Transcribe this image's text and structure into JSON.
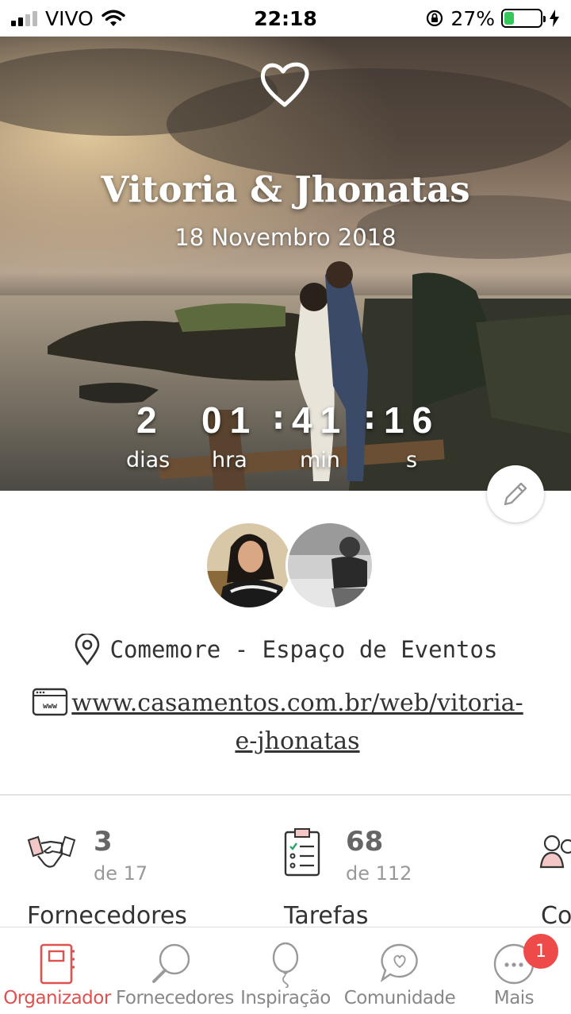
{
  "status_bar": {
    "carrier": "VIVO",
    "time": "22:18",
    "battery_percent": "27%",
    "battery_level": 0.27,
    "battery_color": "#35c759"
  },
  "hero": {
    "logo_icon": "heart-outline-icon",
    "couple_names": "Vitoria & Jhonatas",
    "date": "18 Novembro 2018",
    "countdown": {
      "days": "2",
      "hours": "01",
      "minutes": "41",
      "seconds": "16",
      "days_label": "dias",
      "hours_label": "hra",
      "minutes_label": "min",
      "seconds_label": "s"
    },
    "edit_icon": "pencil-icon"
  },
  "venue": {
    "icon": "location-pin-icon",
    "name": "Comemore - Espaço de Eventos"
  },
  "website": {
    "icon": "browser-window-icon",
    "url": "www.casamentos.com.br/web/vitoria-e-jhonatas"
  },
  "stats": [
    {
      "icon": "handshake-icon",
      "count": "3",
      "of": "de 17",
      "label": "Fornecedores"
    },
    {
      "icon": "checklist-clipboard-icon",
      "count": "68",
      "of": "de 112",
      "label": "Tarefas"
    },
    {
      "icon": "guests-icon",
      "label": "Co"
    }
  ],
  "bottom_nav": [
    {
      "icon": "organizer-book-icon",
      "label": "Organizador",
      "active": true
    },
    {
      "icon": "magnifier-icon",
      "label": "Fornecedores"
    },
    {
      "icon": "balloon-icon",
      "label": "Inspiração"
    },
    {
      "icon": "chat-heart-icon",
      "label": "Comunidade"
    },
    {
      "icon": "more-dots-icon",
      "label": "Mais",
      "badge": "1"
    }
  ],
  "accent_color": "#e0504e"
}
